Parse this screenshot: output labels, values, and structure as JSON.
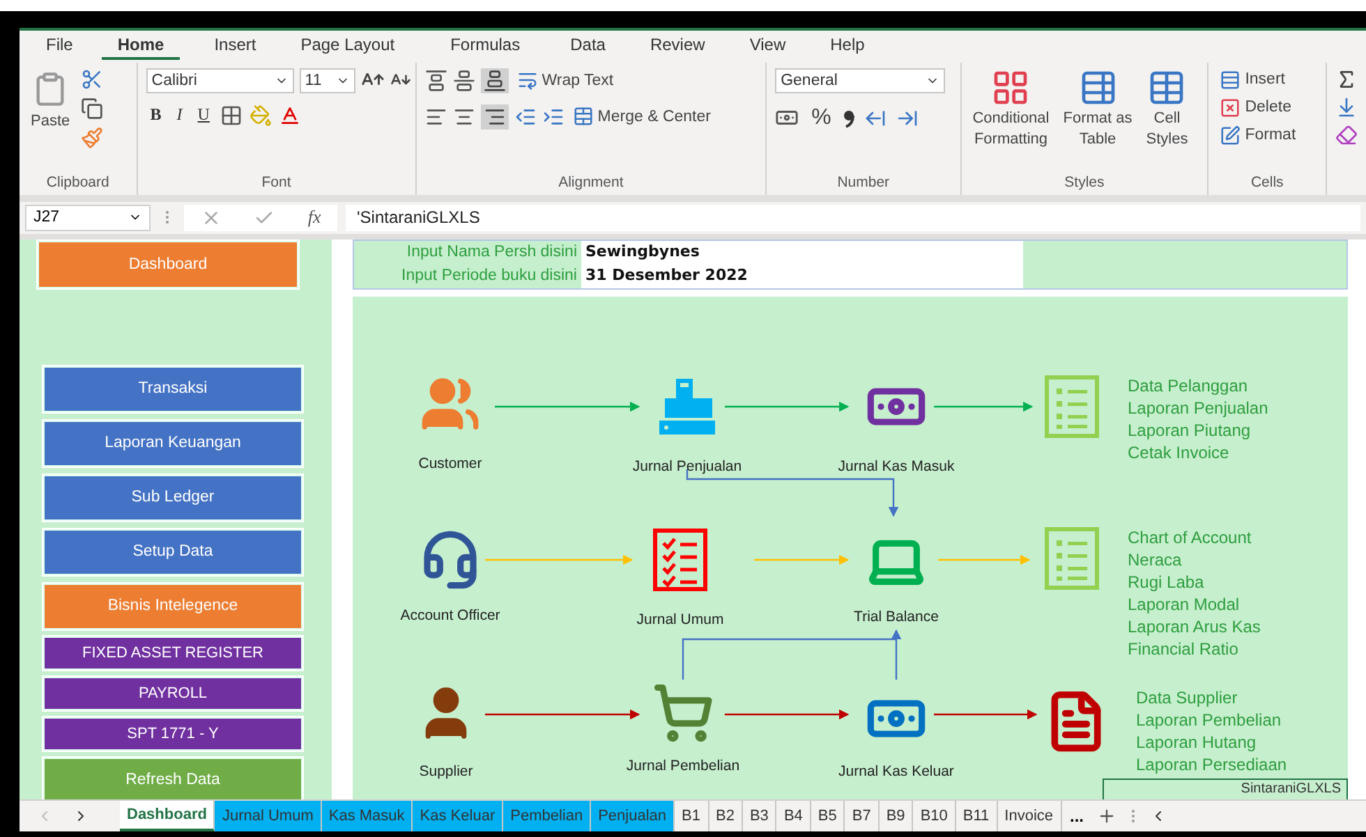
{
  "menu_tabs": [
    {
      "label": "File",
      "selected": false
    },
    {
      "label": "Home",
      "selected": true
    },
    {
      "label": "Insert",
      "selected": false
    },
    {
      "label": "Page Layout",
      "selected": false
    },
    {
      "label": "Formulas",
      "selected": false
    },
    {
      "label": "Data",
      "selected": false
    },
    {
      "label": "Review",
      "selected": false
    },
    {
      "label": "View",
      "selected": false
    },
    {
      "label": "Help",
      "selected": false
    }
  ],
  "ribbon": {
    "paste": "Paste",
    "font_name": "Calibri",
    "font_size": "11",
    "bold": "B",
    "italic": "I",
    "underline": "U",
    "wrap_text": "Wrap Text",
    "merge_center": "Merge & Center",
    "number_format": "General",
    "percent": "%",
    "conditional_formatting": [
      "Conditional",
      "Formatting"
    ],
    "format_as_table": [
      "Format as",
      "Table"
    ],
    "cell_styles": [
      "Cell",
      "Styles"
    ],
    "insert": "Insert",
    "delete": "Delete",
    "format": "Format",
    "groups": [
      "Clipboard",
      "Font",
      "Alignment",
      "Number",
      "Styles",
      "Cells"
    ]
  },
  "formula_bar": {
    "name_box": "J27",
    "function_label": "fx",
    "value": "'SintaraniGLXLS"
  },
  "sidebar": {
    "top_button": {
      "label": "Dashboard",
      "color": "#ed7d31"
    },
    "buttons": [
      {
        "label": "Transaksi",
        "color": "#4472c4",
        "kind": "tall"
      },
      {
        "label": "Laporan Keuangan",
        "color": "#4472c4",
        "kind": "tall"
      },
      {
        "label": "Sub Ledger",
        "color": "#4472c4",
        "kind": "tall"
      },
      {
        "label": "Setup Data",
        "color": "#4472c4",
        "kind": "tall"
      },
      {
        "label": "Bisnis Intelegence",
        "color": "#ed7d31",
        "kind": "tall"
      },
      {
        "label": "FIXED ASSET REGISTER",
        "color": "#7030a0",
        "kind": "short"
      },
      {
        "label": "PAYROLL",
        "color": "#7030a0",
        "kind": "short"
      },
      {
        "label": "SPT 1771 - Y",
        "color": "#7030a0",
        "kind": "short"
      },
      {
        "label": "Refresh Data",
        "color": "#70ad47",
        "kind": "tall"
      }
    ]
  },
  "header": [
    {
      "label": "Input Nama Persh disini",
      "value": "Sewingbynes"
    },
    {
      "label": "Input Periode buku disini",
      "value": "31 Desember 2022"
    }
  ],
  "diagram": {
    "nodes": [
      {
        "kind": "customers",
        "label": "Customer"
      },
      {
        "kind": "register",
        "label": "Jurnal Penjualan"
      },
      {
        "kind": "cash_in",
        "label": "Jurnal Kas Masuk"
      },
      {
        "kind": "officer",
        "label": "Account Officer"
      },
      {
        "kind": "checklist",
        "label": "Jurnal Umum"
      },
      {
        "kind": "laptop",
        "label": "Trial Balance"
      },
      {
        "kind": "supplier",
        "label": "Supplier"
      },
      {
        "kind": "cart",
        "label": "Jurnal Pembelian"
      },
      {
        "kind": "cash_out",
        "label": "Jurnal Kas Keluar"
      }
    ],
    "report_groups": [
      {
        "kind": "list",
        "items": [
          "Data Pelanggan",
          "Laporan Penjualan",
          "Laporan Piutang",
          "Cetak Invoice"
        ]
      },
      {
        "kind": "list",
        "items": [
          "Chart of Account",
          "Neraca",
          "Rugi Laba",
          "Laporan Modal",
          "Laporan Arus Kas",
          "Financial Ratio"
        ]
      },
      {
        "kind": "document",
        "items": [
          "Data Supplier",
          "Laporan Pembelian",
          "Laporan Hutang",
          "Laporan Persediaan"
        ]
      }
    ],
    "footer_box": "SintaraniGLXLS"
  },
  "sheet_tabs": [
    {
      "label": "Dashboard",
      "selected": true
    },
    {
      "label": "Jurnal Umum",
      "selected": false,
      "color": "#00b0f0"
    },
    {
      "label": "Kas Masuk",
      "selected": false,
      "color": "#00b0f0"
    },
    {
      "label": "Kas Keluar",
      "selected": false,
      "color": "#00b0f0"
    },
    {
      "label": "Pembelian",
      "selected": false,
      "color": "#00b0f0"
    },
    {
      "label": "Penjualan",
      "selected": false,
      "color": "#00b0f0"
    },
    {
      "label": "B1",
      "selected": false
    },
    {
      "label": "B2",
      "selected": false
    },
    {
      "label": "B3",
      "selected": false
    },
    {
      "label": "B4",
      "selected": false
    },
    {
      "label": "B5",
      "selected": false
    },
    {
      "label": "B7",
      "selected": false
    },
    {
      "label": "B9",
      "selected": false
    },
    {
      "label": "B10",
      "selected": false
    },
    {
      "label": "B11",
      "selected": false
    },
    {
      "label": "Invoice",
      "selected": false
    }
  ],
  "more_tabs": "..."
}
